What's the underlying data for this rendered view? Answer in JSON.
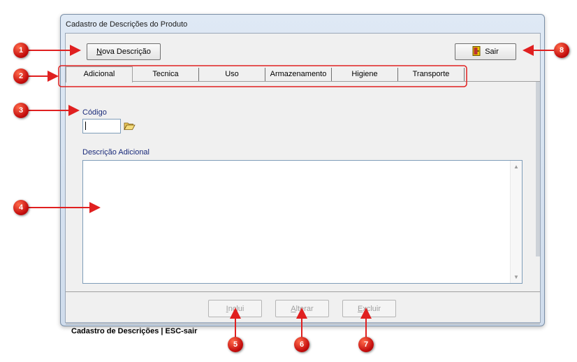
{
  "window": {
    "title": "Cadastro de Descrições do Produto"
  },
  "toolbar": {
    "new_label_prefix": "N",
    "new_label_rest": "ova Descrição",
    "exit_label": "Sair"
  },
  "tabs": [
    "Adicional",
    "Tecnica",
    "Uso",
    "Armazenamento",
    "Higiene",
    "Transporte"
  ],
  "form": {
    "code_label": "Código",
    "code_value": "",
    "description_label": "Descrição Adicional",
    "description_value": ""
  },
  "actions": {
    "include_prefix": "I",
    "include_rest": "nclui",
    "alter_prefix": "A",
    "alter_rest": "lterar",
    "delete_prefix": "E",
    "delete_rest": "xcluir"
  },
  "status": {
    "text": "Cadastro de Descrições  |  ESC-sair"
  },
  "markers": [
    "1",
    "2",
    "3",
    "4",
    "5",
    "6",
    "7",
    "8"
  ],
  "colors": {
    "marker": "#d11212",
    "highlight": "#e02020"
  }
}
